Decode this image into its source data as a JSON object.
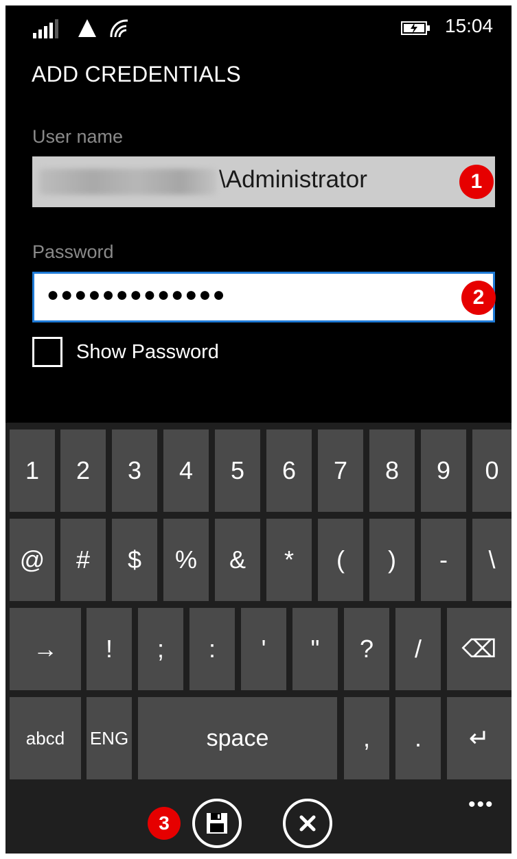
{
  "status_bar": {
    "time": "15:04",
    "icons": [
      "signal-strength-icon",
      "data-connection-icon",
      "wifi-icon",
      "battery-charging-icon"
    ]
  },
  "page": {
    "title": "ADD CREDENTIALS"
  },
  "form": {
    "username_label": "User name",
    "username_value": "\\Administrator",
    "password_label": "Password",
    "password_value": "●●●●●●●●●●●●●",
    "show_password_label": "Show Password",
    "show_password_checked": false
  },
  "markers": [
    "1",
    "2",
    "3"
  ],
  "keyboard": {
    "rows": [
      [
        "1",
        "2",
        "3",
        "4",
        "5",
        "6",
        "7",
        "8",
        "9",
        "0"
      ],
      [
        "@",
        "#",
        "$",
        "%",
        "&",
        "*",
        "(",
        ")",
        "-",
        "\\"
      ],
      [
        "→",
        "!",
        ";",
        ":",
        "'",
        "\"",
        "?",
        "/",
        "⌫"
      ],
      [
        "abcd",
        "ENG",
        "space",
        ",",
        ".",
        "↵"
      ]
    ]
  },
  "app_bar": {
    "more_label": "•••",
    "buttons": [
      "save-icon",
      "close-icon"
    ]
  },
  "colors": {
    "background": "#000000",
    "accent": "#1e7ad6",
    "marker": "#e60000",
    "key": "#4a4a4a",
    "keyboard_bg": "#1f1f1f"
  }
}
